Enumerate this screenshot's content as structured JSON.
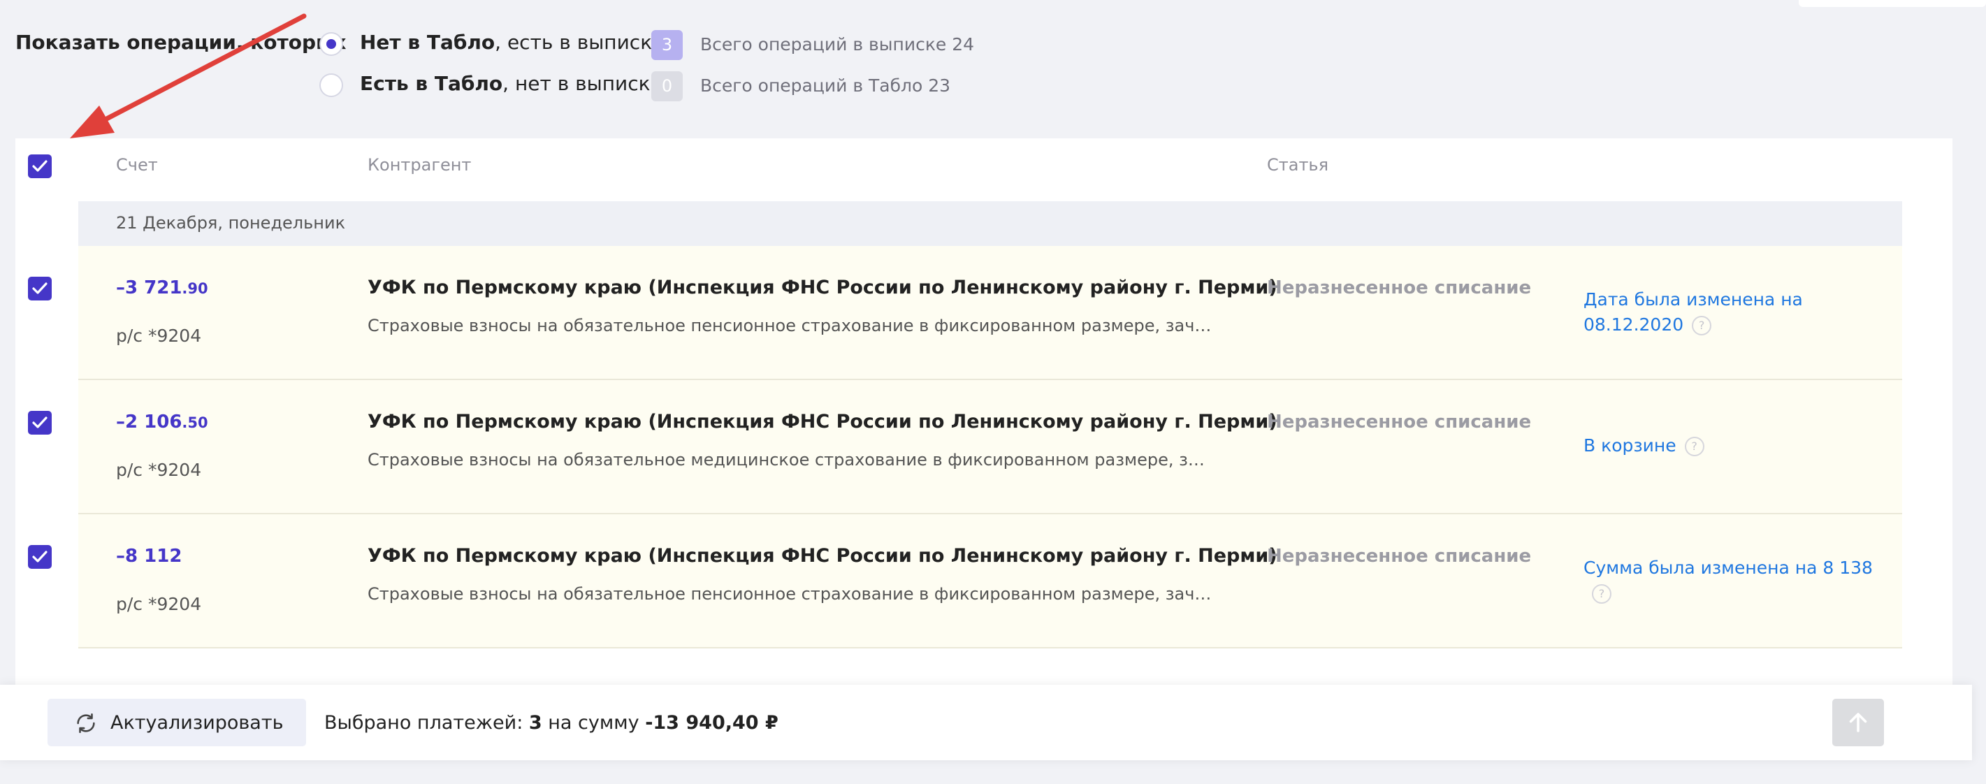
{
  "filter": {
    "title": "Показать операции, которых",
    "option1_bold": "Нет в Табло",
    "option1_rest": ", есть в выписке",
    "option1_count": "3",
    "option1_total": "Всего операций в выписке 24",
    "option2_bold": "Есть в Табло",
    "option2_rest": ", нет в выписке",
    "option2_count": "0",
    "option2_total": "Всего операций в Табло 23"
  },
  "table": {
    "headers": {
      "account": "Счет",
      "counterparty": "Контрагент",
      "article": "Статья"
    },
    "day": "21 Декабря, понедельник",
    "rows": [
      {
        "amount_main": "–3 721",
        "amount_cents": ".90",
        "account": "р/с *9204",
        "counterparty": "УФК по Пермскому краю (Инспекция ФНС России по Ленинскому району г. Перми)",
        "description": "Страховые взносы на обязательное пенсионное страхование в фиксированном размере, зачисляемые в бюджет Пенсионного фонда",
        "article": "Неразнесенное списание",
        "note": "Дата была изменена на 08.12.2020"
      },
      {
        "amount_main": "–2 106",
        "amount_cents": ".50",
        "account": "р/с *9204",
        "counterparty": "УФК по Пермскому краю (Инспекция ФНС России по Ленинскому району г. Перми)",
        "description": "Страховые взносы на обязательное медицинское страхование в фиксированном размере, зачисляемые в бюджет Федерального фонда",
        "article": "Неразнесенное списание",
        "note": "В корзине"
      },
      {
        "amount_main": "–8 112",
        "amount_cents": "",
        "account": "р/с *9204",
        "counterparty": "УФК по Пермскому краю (Инспекция ФНС России по Ленинскому району г. Перми)",
        "description": "Страховые взносы на обязательное пенсионное страхование в фиксированном размере, зачисляемые в бюджет Пенсионного фонда",
        "article": "Неразнесенное списание",
        "note": "Сумма была изменена на 8 138"
      }
    ]
  },
  "bottom": {
    "refresh_label": "Актуализировать",
    "summary_prefix": "Выбрано платежей: ",
    "summary_count": "3",
    "summary_middle": " на сумму ",
    "summary_amount": "-13 940,40 ₽"
  },
  "icons": {
    "arrow": "annotation-arrow",
    "check": "check-icon",
    "refresh": "refresh-icon",
    "up": "arrow-up-icon",
    "help": "help-icon"
  },
  "colors": {
    "accent": "#4536c8",
    "link": "#1f77e0",
    "row_bg": "#fefdf2",
    "arrow": "#e0403a"
  }
}
